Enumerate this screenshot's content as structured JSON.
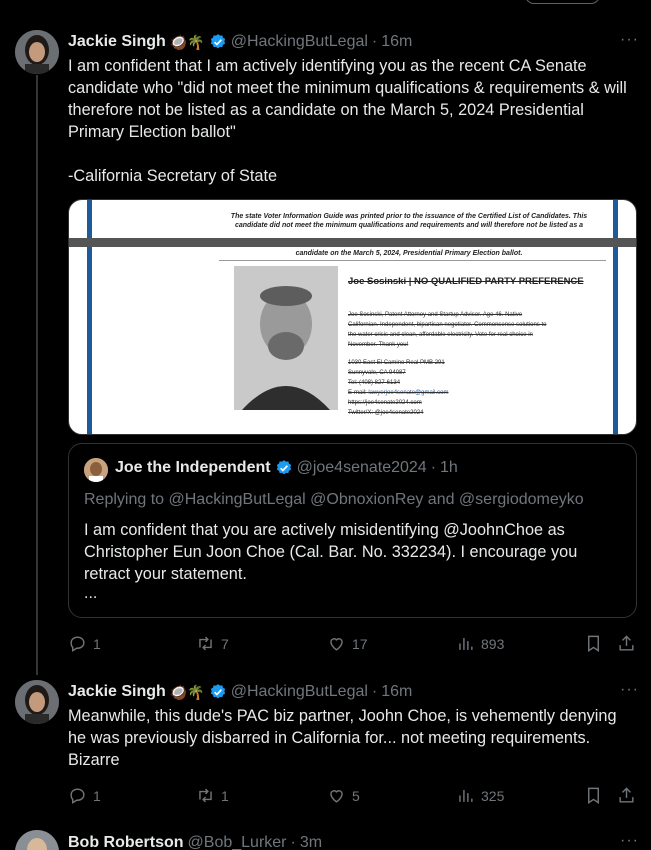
{
  "thread_tweet": {
    "author": {
      "name": "Jackie Singh",
      "emoji": "🥥🌴",
      "handle": "@HackingButLegal",
      "time": "16m"
    },
    "text": "I am confident that I am actively identifying you as the recent CA Senate candidate who \"did not meet the minimum qualifications & requirements & will therefore not be listed as a candidate on the March 5, 2024 Presidential Primary Election ballot\"\n\n-California Secretary of State",
    "media": {
      "notice": "The state Voter Information Guide was printed prior to the issuance of the Certified List of Candidates. This candidate did not meet the minimum qualifications and requirements and will therefore not be listed as a",
      "notice2": "candidate on the March 5, 2024, Presidential Primary Election ballot.",
      "candidate_title": "Joe Sosinski | NO QUALIFIED PARTY PREFERENCE",
      "bio": [
        "Joe Sosinski, Patent Attorney and Startup Advisor. Age 46. Native",
        "Californian. Independent, bipartisan negotiator. Commonsense solutions to",
        "the water crisis and clean, affordable electricity. Vote for real choice in",
        "November. Thank you!"
      ],
      "address": [
        "1030 East El Camino Real PMB 291",
        "Sunnyvale, CA 94087",
        "Tel: (408) 827-6134"
      ],
      "email_label": "E-mail:",
      "email": "lawyerjoe4senate@gmail.com",
      "web": "https://joe4senate2024.com",
      "twitter": "Twitter/X: @joe4senate2024"
    },
    "quote": {
      "name": "Joe the Independent",
      "handle": "@joe4senate2024",
      "time": "1h",
      "replying_label": "Replying to",
      "replying_to": "@HackingButLegal @ObnoxionRey and @sergiodomeyko",
      "text": "I am confident that you are actively misidentifying @JoohnChoe as Christopher Eun Joon Choe (Cal. Bar. No. 332234). I encourage you retract your statement.",
      "more": "..."
    },
    "stats": {
      "replies": "1",
      "retweets": "7",
      "likes": "17",
      "views": "893"
    }
  },
  "second_tweet": {
    "author": {
      "name": "Jackie Singh",
      "emoji": "🥥🌴",
      "handle": "@HackingButLegal",
      "time": "16m"
    },
    "text": "Meanwhile, this dude's PAC biz partner, Joohn Choe, is vehemently denying he was previously disbarred in California for... not meeting requirements. Bizarre",
    "stats": {
      "replies": "1",
      "retweets": "1",
      "likes": "5",
      "views": "325"
    }
  },
  "third_tweet": {
    "author": {
      "name": "Bob Robertson",
      "handle": "@Bob_Lurker",
      "time": "3m"
    }
  },
  "icons": {
    "more": "more-dots-icon",
    "reply": "reply-icon",
    "retweet": "retweet-icon",
    "like": "heart-icon",
    "views": "views-icon",
    "bookmark": "bookmark-icon",
    "share": "share-icon",
    "verified": "verified-badge-icon"
  },
  "colors": {
    "background": "#000000",
    "text": "#e7e9ea",
    "muted": "#71767b",
    "verified": "#1d9bf0",
    "border": "#2f3336"
  },
  "ui": {
    "dot": "·",
    "more_label": "···"
  }
}
